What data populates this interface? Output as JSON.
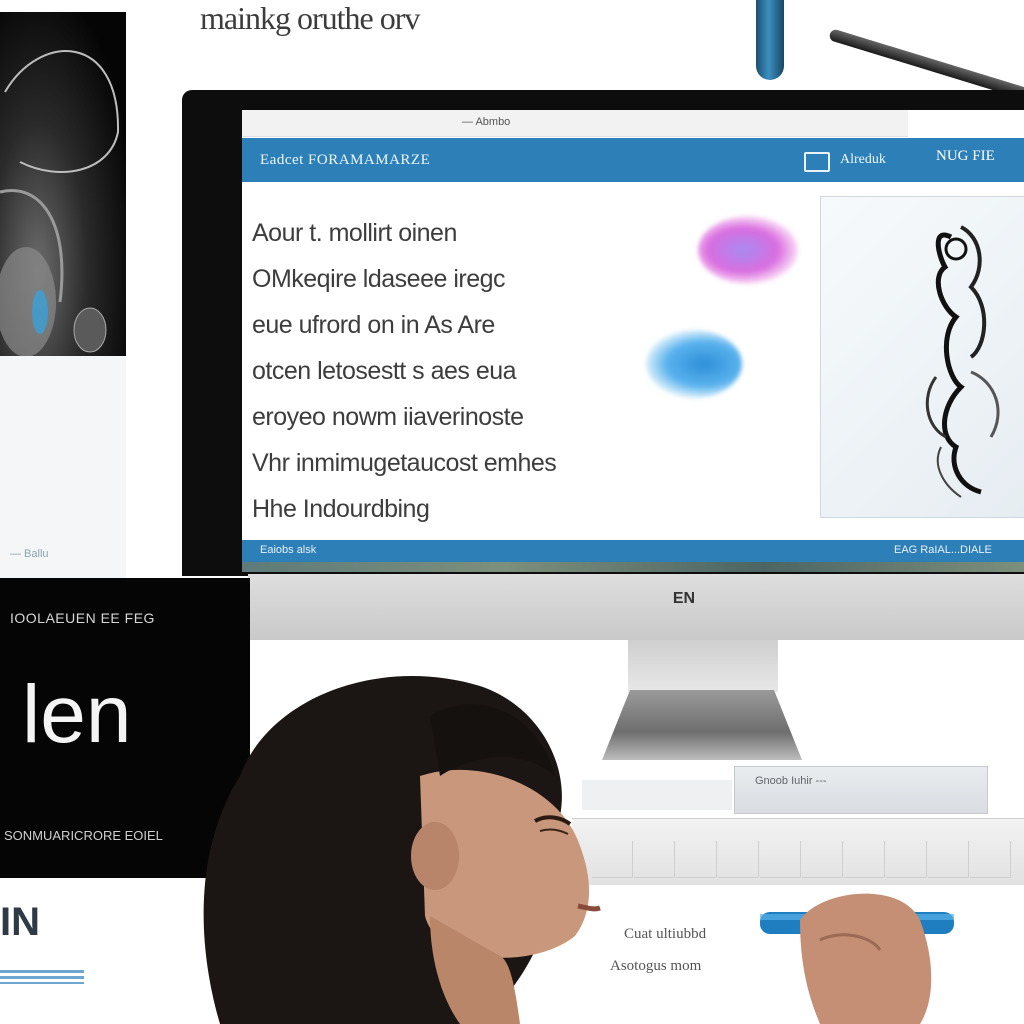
{
  "top_title": "mainkg oruthe orv",
  "address_bar": {
    "text": "— Abmbo"
  },
  "app": {
    "title": "Eadcet FORAMAMARZE",
    "header_search": "Alreduk",
    "header_user": "NUG FIE"
  },
  "content_lines": [
    "Aour  t. mollirt oinen",
    "OMkeqire ldaseee iregc",
    "eue ufrord on in As Are",
    "otcen letosestt s aes eua",
    "eroyeo nowm iiaverinoste",
    "Vhr inmimugetaucost emhes",
    "Hhe Indourdbing"
  ],
  "status_bar": {
    "left": "Eaiobs  alsk",
    "right": "EAG RaIAL...DIALE"
  },
  "chin_logo": "EN",
  "left_photo_caption": "— Ballu",
  "sign": {
    "caption_top": "IOOLAEUEN EE FEG",
    "big_text": "len",
    "caption_bottom": "SONMUARICRORE EOIEL"
  },
  "under_sign_text": "IN",
  "shelf_label": "Gnoob Iuhir   ---",
  "paper_text": [
    "Cuat ultiubbd",
    "Asotogus mom"
  ],
  "colors": {
    "accent_blue": "#2d7fb8",
    "screen_bg": "#ffffff",
    "sign_bg": "#050505"
  }
}
